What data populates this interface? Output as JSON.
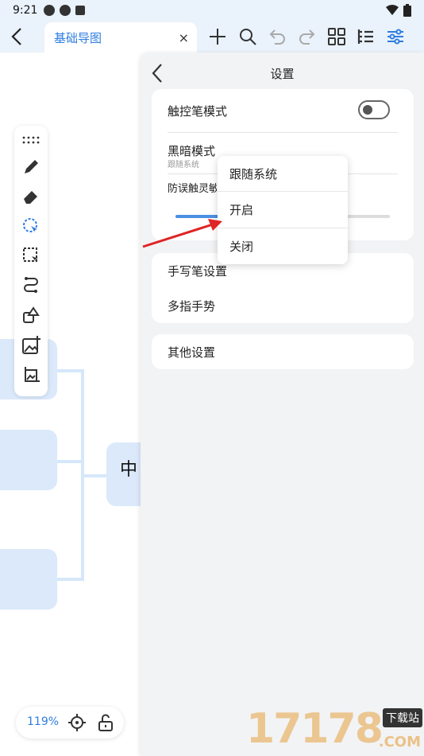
{
  "status_bar": {
    "time": "9:21"
  },
  "toolbar": {
    "tab_title": "基础导图",
    "tab_close": "×",
    "icons": [
      "back-icon",
      "add-icon",
      "search-icon",
      "undo-icon",
      "redo-icon",
      "grid-icon",
      "outline-icon",
      "settings-sliders-icon"
    ]
  },
  "canvas": {
    "center_node_text": "中"
  },
  "palette": {
    "icons": [
      "more-dots-icon",
      "pen-icon",
      "eraser-icon",
      "lasso-select-icon",
      "rect-select-icon",
      "connector-icon",
      "shape-icon",
      "insert-image-icon",
      "crop-image-icon"
    ]
  },
  "zoom": {
    "value": "119%"
  },
  "panel": {
    "title": "设置",
    "stylus_mode_label": "触控笔模式",
    "dark_mode_label": "黑暗模式",
    "dark_mode_sub": "跟随系统",
    "sensitivity_label": "防误触灵敏度",
    "sensitivity_level": 0.2,
    "handwriting_label": "手写笔设置",
    "multitouch_label": "多指手势",
    "other_label": "其他设置"
  },
  "popup": {
    "options": [
      "跟随系统",
      "开启",
      "关闭"
    ]
  },
  "colors": {
    "accent": "#2f7de1",
    "node_fill": "#dbe9fb",
    "arrow": "#e02424"
  },
  "watermark": {
    "text": "17178",
    "badge": "下载站",
    "sub": ".COM"
  }
}
